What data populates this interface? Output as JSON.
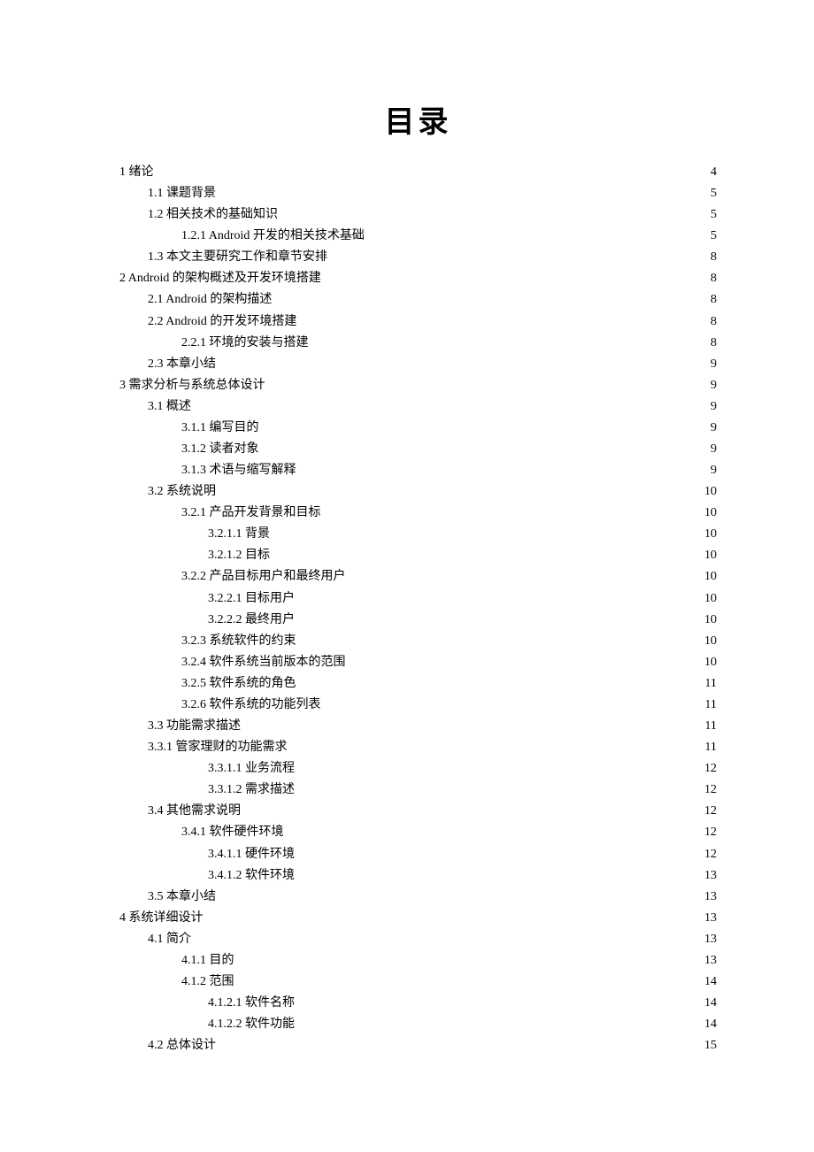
{
  "title": "目录",
  "toc": [
    {
      "level": 0,
      "label": "1 绪论",
      "page": "4"
    },
    {
      "level": 1,
      "label": "1.1 课题背景",
      "page": "5"
    },
    {
      "level": 1,
      "label": "1.2 相关技术的基础知识",
      "page": "5"
    },
    {
      "level": 2,
      "label": "1.2.1 Android 开发的相关技术基础",
      "page": "5"
    },
    {
      "level": 1,
      "label": "1.3  本文主要研究工作和章节安排",
      "page": "8"
    },
    {
      "level": 0,
      "label": "2 Android 的架构概述及开发环境搭建",
      "page": "8"
    },
    {
      "level": 1,
      "label": "2.1 Android 的架构描述",
      "page": "8"
    },
    {
      "level": 1,
      "label": "2.2 Android 的开发环境搭建",
      "page": "8"
    },
    {
      "level": 2,
      "label": "2.2.1  环境的安装与搭建",
      "page": "8"
    },
    {
      "level": 1,
      "label": "2.3  本章小结",
      "page": "9"
    },
    {
      "level": 0,
      "label": "3  需求分析与系统总体设计",
      "page": "9"
    },
    {
      "level": 1,
      "label": "3.1    概述",
      "page": "9"
    },
    {
      "level": 2,
      "label": "3.1.1 编写目的",
      "page": "9"
    },
    {
      "level": 2,
      "label": "3.1.2 读者对象",
      "page": "9"
    },
    {
      "level": 2,
      "label": "3.1.3 术语与缩写解释",
      "page": "9"
    },
    {
      "level": 1,
      "label": "3.2    系统说明",
      "page": "10"
    },
    {
      "level": 2,
      "label": "3.2.1 产品开发背景和目标",
      "page": "10"
    },
    {
      "level": 3,
      "label": "3.2.1.1    背景",
      "page": "10"
    },
    {
      "level": 3,
      "label": "3.2.1.2    目标",
      "page": "10"
    },
    {
      "level": 2,
      "label": "3.2.2  产品目标用户和最终用户",
      "page": "10"
    },
    {
      "level": 3,
      "label": "3.2.2.1  目标用户",
      "page": "10"
    },
    {
      "level": 3,
      "label": "3.2.2.2  最终用户",
      "page": "10"
    },
    {
      "level": 2,
      "label": "3.2.3  系统软件的约束",
      "page": "10"
    },
    {
      "level": 2,
      "label": "3.2.4  软件系统当前版本的范围",
      "page": "10"
    },
    {
      "level": 2,
      "label": "3.2.5  软件系统的角色",
      "page": "11"
    },
    {
      "level": 2,
      "label": "3.2.6  软件系统的功能列表",
      "page": "11"
    },
    {
      "level": 1,
      "label": "3.3  功能需求描述",
      "page": "11"
    },
    {
      "level": 1,
      "label": "3.3.1 管家理财的功能需求",
      "page": "11"
    },
    {
      "level": 3,
      "label": "3.3.1.1  业务流程",
      "page": "12"
    },
    {
      "level": 3,
      "label": "3.3.1.2  需求描述",
      "page": "12"
    },
    {
      "level": 1,
      "label": "3.4 其他需求说明",
      "page": "12"
    },
    {
      "level": 2,
      "label": "3.4.1 软件硬件环境",
      "page": "12"
    },
    {
      "level": 3,
      "label": "3.4.1.1 硬件环境",
      "page": "12"
    },
    {
      "level": 3,
      "label": "3.4.1.2  软件环境",
      "page": "13"
    },
    {
      "level": 1,
      "label": "3.5  本章小结",
      "page": "13"
    },
    {
      "level": 0,
      "label": "4  系统详细设计",
      "page": "13"
    },
    {
      "level": 1,
      "label": "4.1  简介",
      "page": "13"
    },
    {
      "level": 2,
      "label": "4.1.1 目的",
      "page": "13"
    },
    {
      "level": 2,
      "label": "4.1.2  范围",
      "page": "14"
    },
    {
      "level": 3,
      "label": "4.1.2.1  软件名称",
      "page": "14"
    },
    {
      "level": 3,
      "label": "4.1.2.2  软件功能",
      "page": "14"
    },
    {
      "level": 1,
      "label": "4.2  总体设计",
      "page": "15"
    }
  ]
}
